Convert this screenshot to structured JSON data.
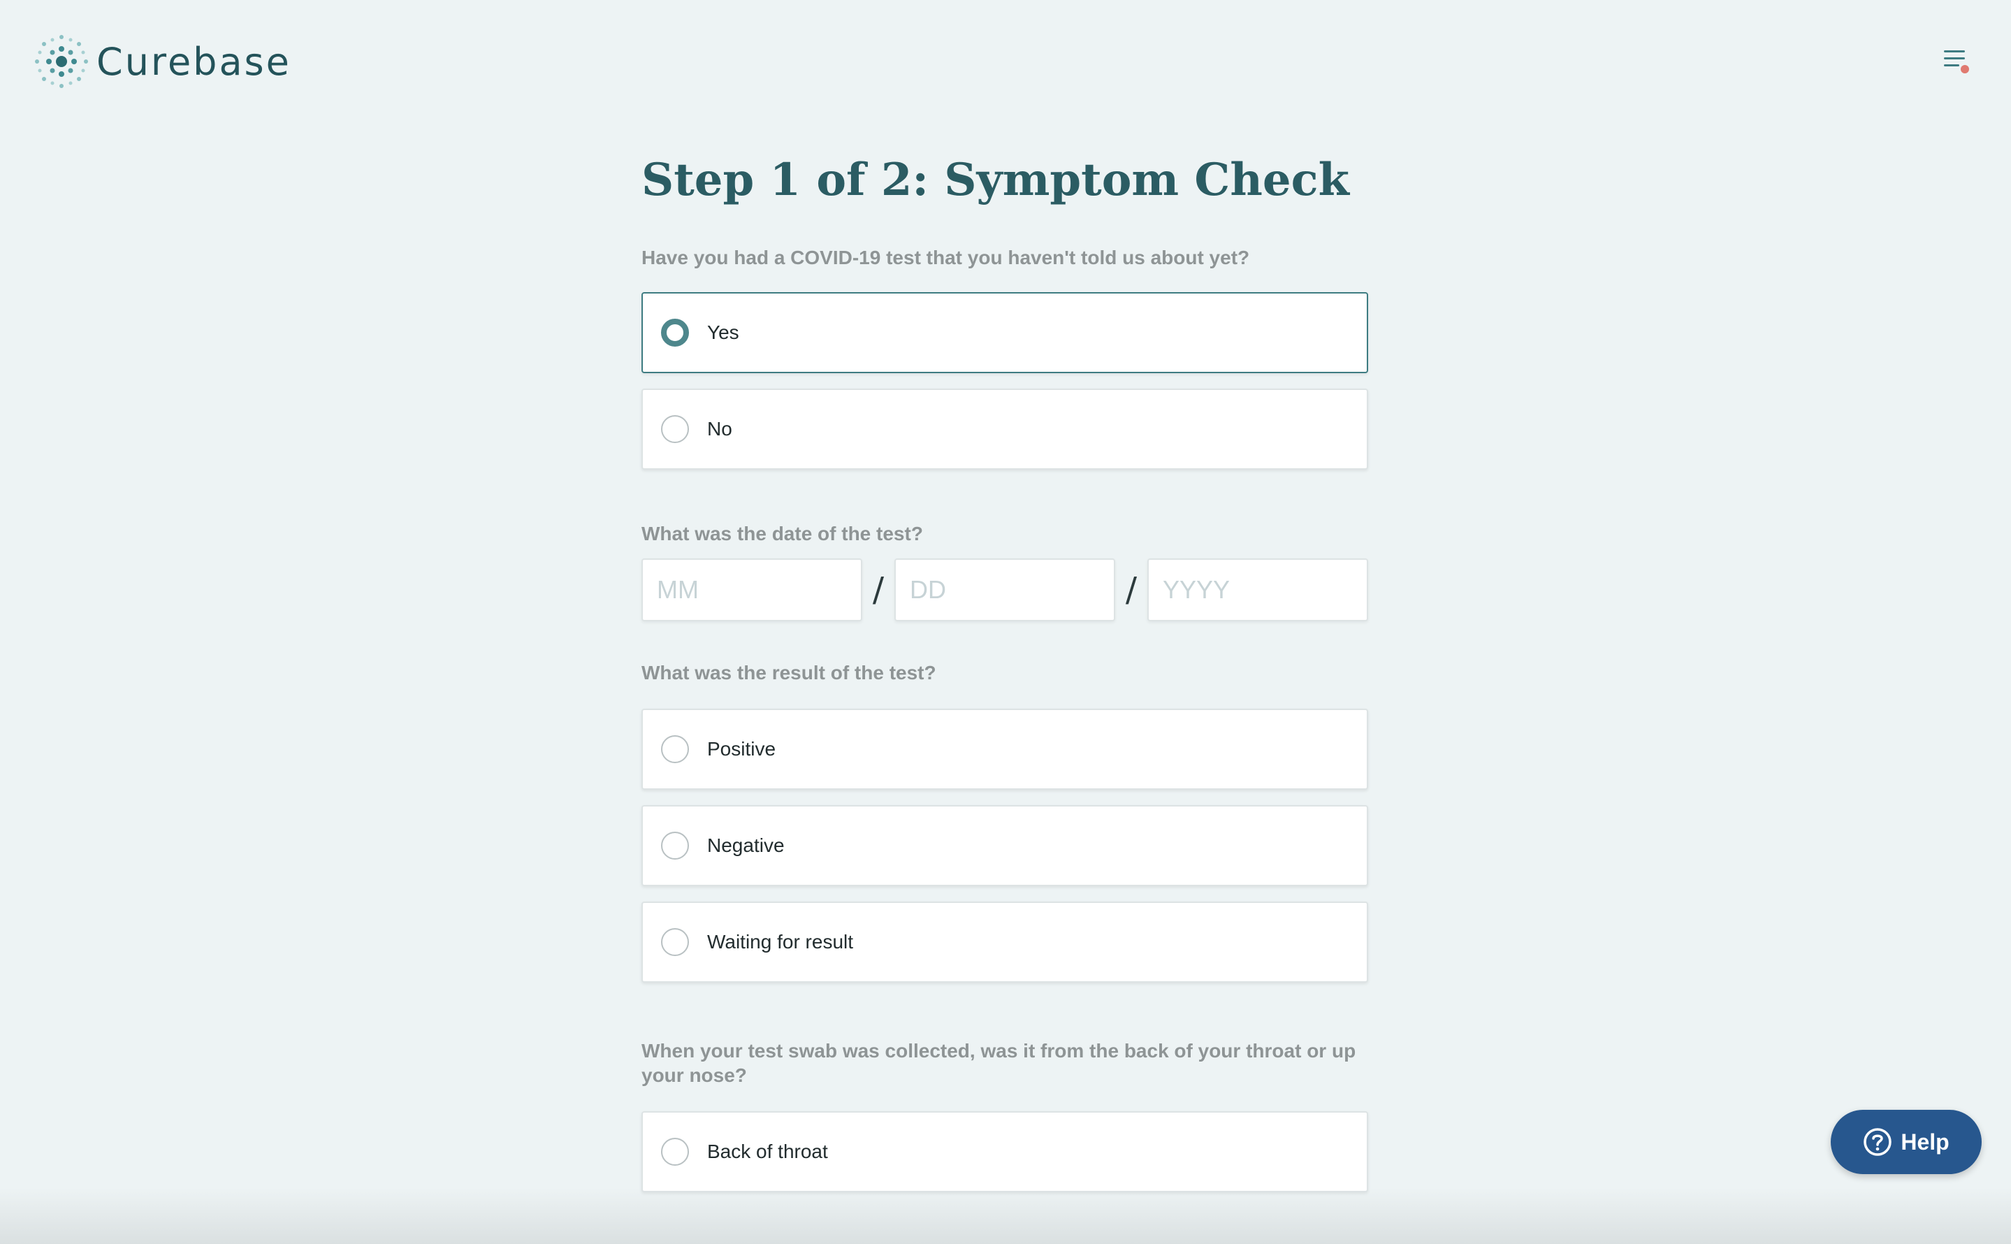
{
  "header": {
    "brand": "Curebase",
    "menu_icon": "menu-icon",
    "notification_color": "#e07a70"
  },
  "page": {
    "title": "Step 1 of 2: Symptom Check"
  },
  "q_test": {
    "label": "Have you had a COVID-19 test that you haven't told us about yet?",
    "options": [
      "Yes",
      "No"
    ],
    "selected": "Yes"
  },
  "q_date": {
    "label": "What was the date of the test?",
    "month_placeholder": "MM",
    "day_placeholder": "DD",
    "year_placeholder": "YYYY",
    "separator": "/"
  },
  "q_result": {
    "label": "What was the result of the test?",
    "options": [
      "Positive",
      "Negative",
      "Waiting for result"
    ]
  },
  "q_swab": {
    "label": "When your test swab was collected, was it from the back of your throat or up your nose?",
    "options": [
      "Back of throat"
    ]
  },
  "help": {
    "label": "Help",
    "icon": "question-circle-icon"
  },
  "colors": {
    "accent": "#2b5c63",
    "selected_radio": "#4e878c",
    "help_button": "#27578e",
    "background": "#edf3f4"
  }
}
